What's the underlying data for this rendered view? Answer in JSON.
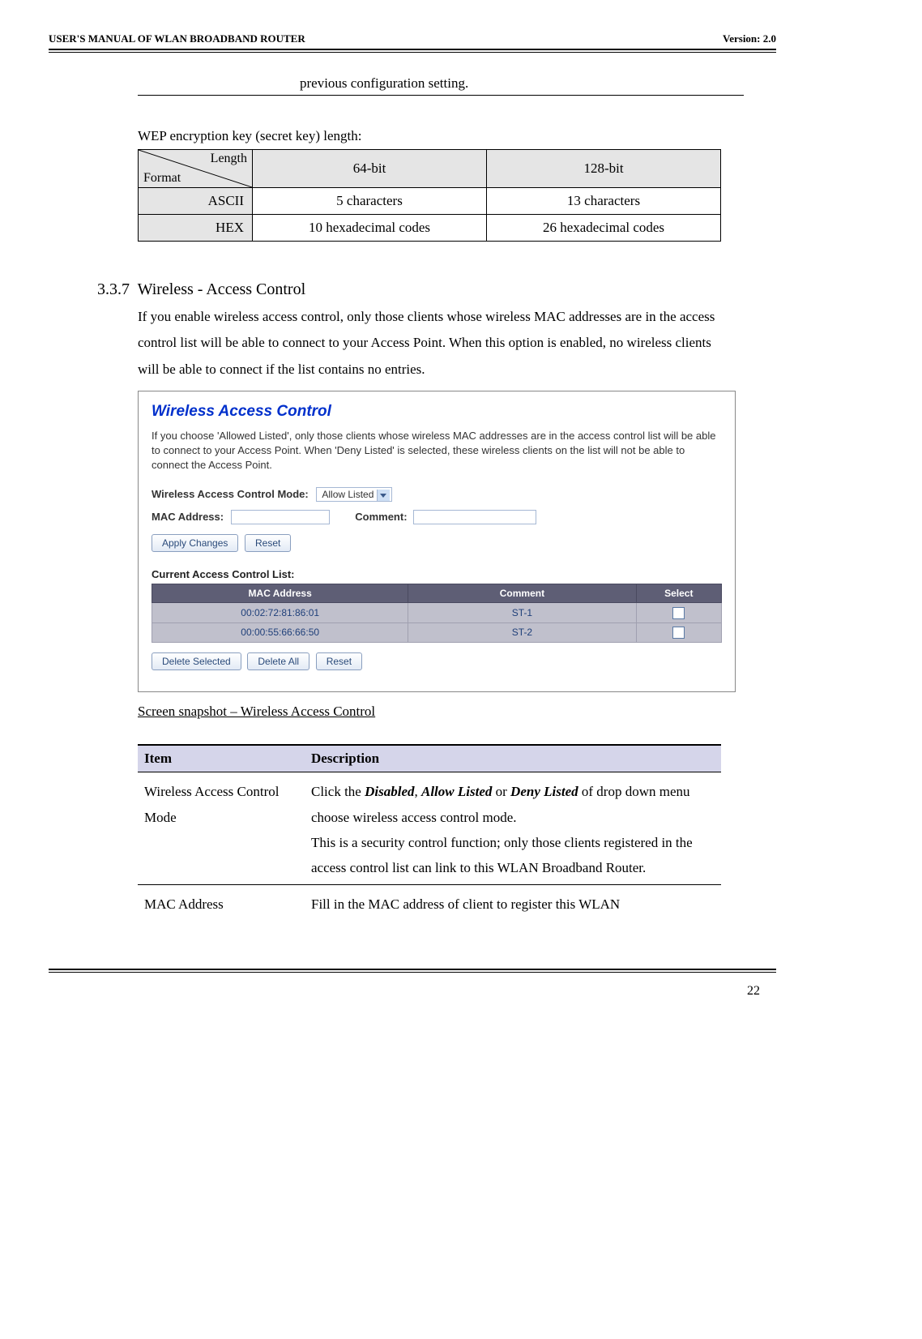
{
  "header": {
    "left": "USER'S MANUAL OF WLAN BROADBAND ROUTER",
    "right": "Version: 2.0"
  },
  "continuation_text": "previous configuration setting.",
  "wep": {
    "intro": "WEP encryption key (secret key) length:",
    "diag_top": "Length",
    "diag_bottom": "Format",
    "col1": "64-bit",
    "col2": "128-bit",
    "row1_label": "ASCII",
    "row1_c1": "5 characters",
    "row1_c2": "13 characters",
    "row2_label": "HEX",
    "row2_c1": "10 hexadecimal codes",
    "row2_c2": "26 hexadecimal codes"
  },
  "section": {
    "number": "3.3.7",
    "title": "Wireless - Access Control",
    "body": "If you enable wireless access control, only those clients whose wireless MAC addresses are in the access control list will be able to connect to your Access Point. When this option is enabled, no wireless clients will be able to connect if the list contains no entries."
  },
  "panel": {
    "title": "Wireless Access Control",
    "desc": "If you choose 'Allowed Listed', only those clients whose wireless MAC addresses are in the access control list will be able to connect to your Access Point. When 'Deny Listed' is selected, these wireless clients on the list will not be able to connect the Access Point.",
    "mode_label": "Wireless Access Control Mode:",
    "mode_value": "Allow Listed",
    "mac_label": "MAC Address:",
    "comment_label": "Comment:",
    "apply": "Apply Changes",
    "reset": "Reset",
    "list_title": "Current Access Control List:",
    "cols": {
      "mac": "MAC Address",
      "comment": "Comment",
      "select": "Select"
    },
    "rows": [
      {
        "mac": "00:02:72:81:86:01",
        "comment": "ST-1"
      },
      {
        "mac": "00:00:55:66:66:50",
        "comment": "ST-2"
      }
    ],
    "del_sel": "Delete Selected",
    "del_all": "Delete All",
    "reset2": "Reset"
  },
  "caption": "Screen snapshot – Wireless Access Control",
  "desc_table": {
    "h1": "Item",
    "h2": "Description",
    "rows": [
      {
        "item": "Wireless Access Control Mode",
        "desc_pre": "Click the ",
        "opt1": "Disabled",
        "sep1": ", ",
        "opt2": "Allow Listed",
        "sep2": " or ",
        "opt3": "Deny Listed",
        "desc_mid": " of drop down menu choose wireless access control mode.",
        "desc_rest": "This is a security control function; only those clients registered in the access control list can link to this WLAN Broadband Router."
      },
      {
        "item": "MAC Address",
        "desc_plain": "Fill in the MAC address of client to register this WLAN"
      }
    ]
  },
  "page_number": "22"
}
